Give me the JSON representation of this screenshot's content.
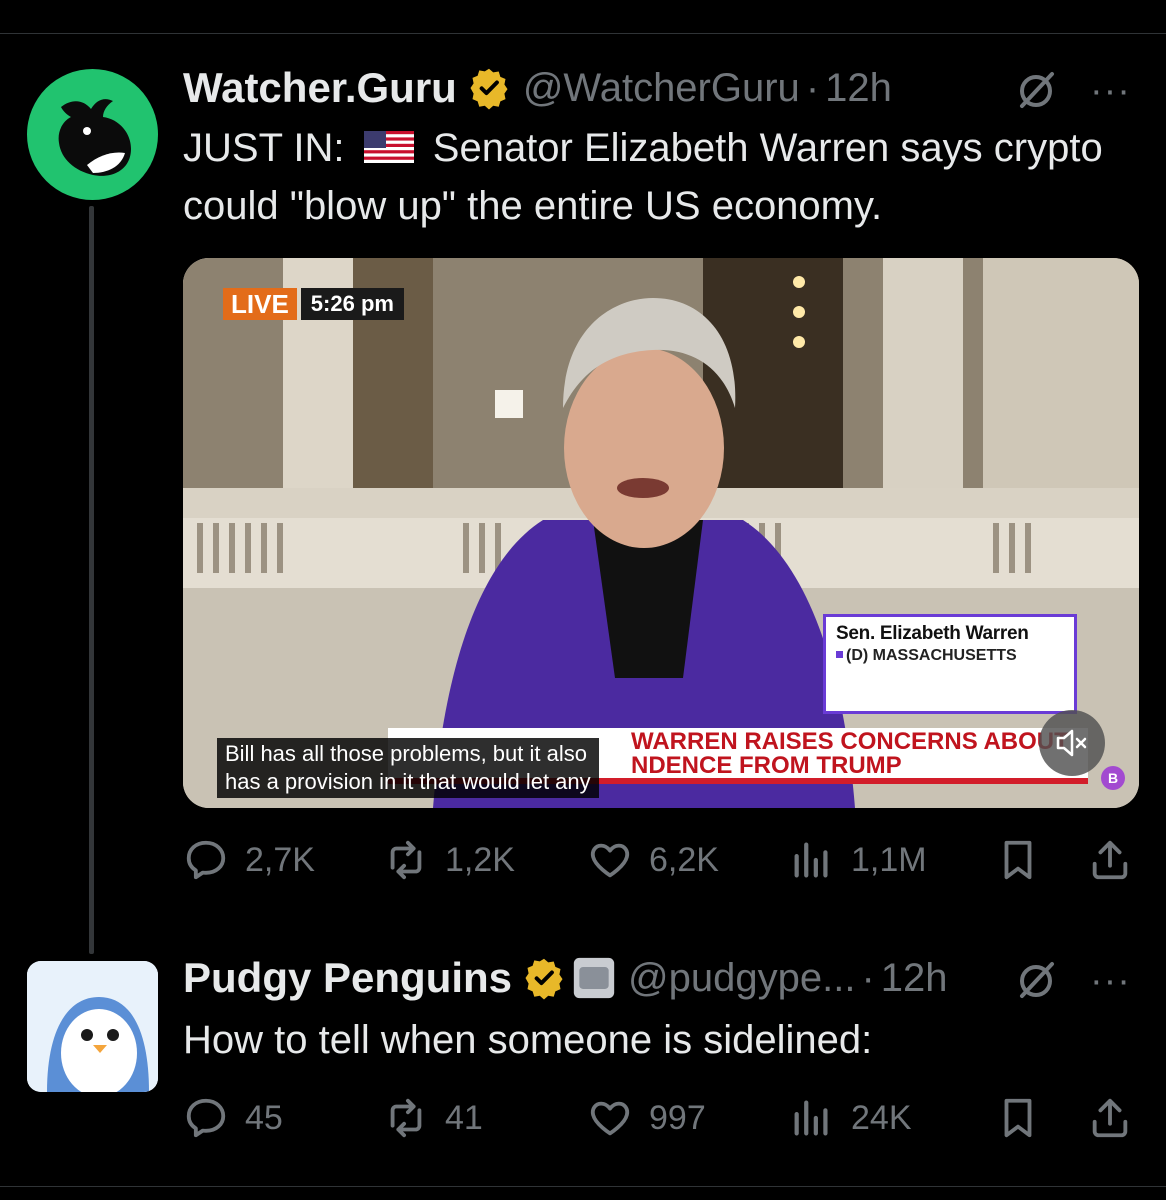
{
  "tweets": [
    {
      "author_name": "Watcher.Guru",
      "handle": "@WatcherGuru",
      "separator": "·",
      "time": "12h",
      "text_prefix": "JUST IN:",
      "text_flag": "us-flag",
      "text_body": "Senator Elizabeth Warren says crypto could \"blow up\" the entire US economy.",
      "more": "···",
      "media": {
        "live_label": "LIVE",
        "live_time": "5:26 pm",
        "lower_third_name": "Sen. Elizabeth Warren",
        "lower_third_party": "(D) MASSACHUSETTS",
        "headline_line1": "WARREN RAISES CONCERNS ABOUT",
        "headline_line2": "NDENCE FROM TRUMP",
        "caption_line1": "Bill has all those problems, but it also",
        "caption_line2": "has a provision in it that would let any",
        "corner_badge": "B"
      },
      "stats": {
        "replies": "2,7K",
        "reposts": "1,2K",
        "likes": "6,2K",
        "views": "1,1M"
      }
    },
    {
      "author_name": "Pudgy Penguins",
      "handle": "@pudgype...",
      "separator": "·",
      "time": "12h",
      "text": "How to tell when someone is sidelined:",
      "more": "···",
      "stats": {
        "replies": "45",
        "reposts": "41",
        "likes": "997",
        "views": "24K"
      }
    }
  ],
  "colors": {
    "background": "#000000",
    "text": "#e7e9ea",
    "muted": "#71767b",
    "verified_gold": "#e8b829",
    "watcher_green": "#21c36f"
  },
  "icons": [
    "whale-logo",
    "penguin-logo",
    "verified-gold-badge",
    "grok-icon",
    "more-icon",
    "reply-icon",
    "repost-icon",
    "like-icon",
    "views-icon",
    "bookmark-icon",
    "share-icon",
    "mute-icon"
  ]
}
